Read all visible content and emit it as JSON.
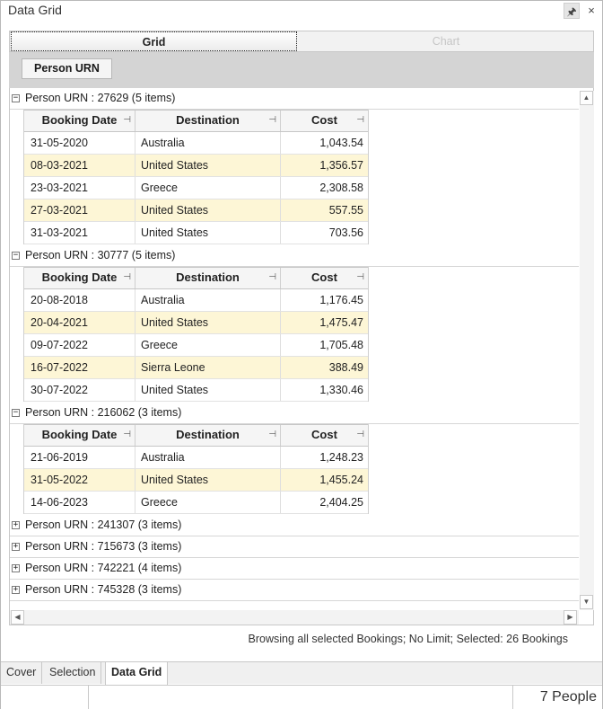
{
  "window": {
    "title": "Data Grid",
    "pin_glyph": "🖈",
    "close_glyph": "×"
  },
  "tabs": {
    "grid_label": "Grid",
    "chart_label": "Chart"
  },
  "group_panel": {
    "chip_label": "Person URN"
  },
  "columns": {
    "date": "Booking Date",
    "destination": "Destination",
    "cost": "Cost",
    "pin_glyph": "⊣"
  },
  "groups": [
    {
      "label": "Person URN : 27629 (5 items)",
      "expanded": true,
      "rows": [
        {
          "date": "31-05-2020",
          "destination": "Australia",
          "cost": "1,043.54",
          "highlight": false
        },
        {
          "date": "08-03-2021",
          "destination": "United States",
          "cost": "1,356.57",
          "highlight": true
        },
        {
          "date": "23-03-2021",
          "destination": "Greece",
          "cost": "2,308.58",
          "highlight": false
        },
        {
          "date": "27-03-2021",
          "destination": "United States",
          "cost": "557.55",
          "highlight": true
        },
        {
          "date": "31-03-2021",
          "destination": "United States",
          "cost": "703.56",
          "highlight": false
        }
      ]
    },
    {
      "label": "Person URN : 30777 (5 items)",
      "expanded": true,
      "rows": [
        {
          "date": "20-08-2018",
          "destination": "Australia",
          "cost": "1,176.45",
          "highlight": false
        },
        {
          "date": "20-04-2021",
          "destination": "United States",
          "cost": "1,475.47",
          "highlight": true
        },
        {
          "date": "09-07-2022",
          "destination": "Greece",
          "cost": "1,705.48",
          "highlight": false
        },
        {
          "date": "16-07-2022",
          "destination": "Sierra Leone",
          "cost": "388.49",
          "highlight": true
        },
        {
          "date": "30-07-2022",
          "destination": "United States",
          "cost": "1,330.46",
          "highlight": false
        }
      ]
    },
    {
      "label": "Person URN : 216062 (3 items)",
      "expanded": true,
      "rows": [
        {
          "date": "21-06-2019",
          "destination": "Australia",
          "cost": "1,248.23",
          "highlight": false
        },
        {
          "date": "31-05-2022",
          "destination": "United States",
          "cost": "1,455.24",
          "highlight": true
        },
        {
          "date": "14-06-2023",
          "destination": "Greece",
          "cost": "2,404.25",
          "highlight": false
        }
      ]
    },
    {
      "label": "Person URN : 241307 (3 items)",
      "expanded": false,
      "rows": []
    },
    {
      "label": "Person URN : 715673 (3 items)",
      "expanded": false,
      "rows": []
    },
    {
      "label": "Person URN : 742221 (4 items)",
      "expanded": false,
      "rows": []
    },
    {
      "label": "Person URN : 745328 (3 items)",
      "expanded": false,
      "rows": []
    }
  ],
  "expander": {
    "expanded_glyph": "−",
    "collapsed_glyph": "+"
  },
  "scroll": {
    "up_glyph": "▲",
    "down_glyph": "▼",
    "left_glyph": "◀",
    "right_glyph": "▶"
  },
  "status": {
    "text": "Browsing all selected Bookings; No Limit; Selected: 26 Bookings"
  },
  "bottom_tabs": [
    {
      "label": "Cover",
      "active": false
    },
    {
      "label": "Selection",
      "active": false
    },
    {
      "label": "Data Grid",
      "active": true
    }
  ],
  "status_bar": {
    "count_text": "7 People"
  },
  "colors": {
    "highlight_row": "#fdf6d6",
    "group_panel": "#d4d4d4"
  }
}
